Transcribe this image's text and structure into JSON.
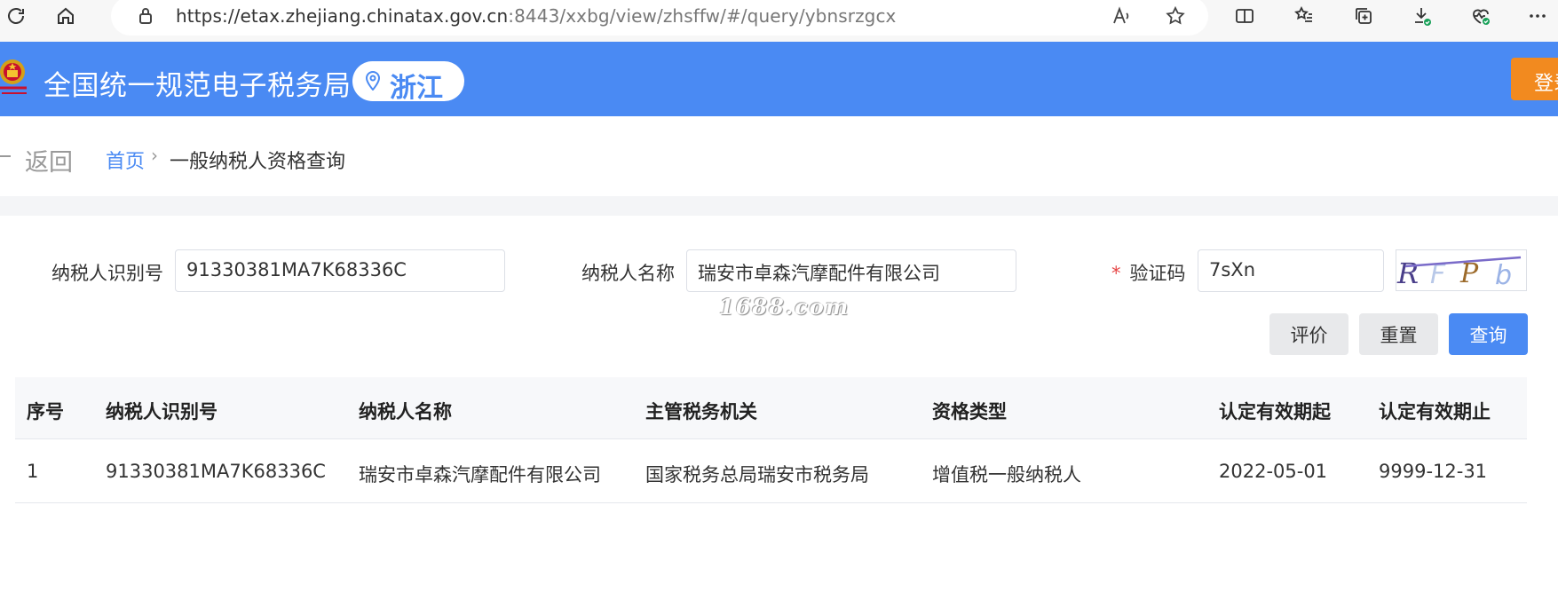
{
  "browser": {
    "url_host": "https://etax.zhejiang.chinatax.gov.cn",
    "url_path": ":8443/xxbg/view/zhsffw/#/query/ybnsrzgcx"
  },
  "header": {
    "title": "全国统一规范电子税务局",
    "region": "浙江",
    "login": "登录",
    "brand_color": "#4a8af3"
  },
  "breadcrumb": {
    "back": "返回",
    "home": "首页",
    "separator": "›",
    "current": "一般纳税人资格查询"
  },
  "form": {
    "taxpayer_id_label": "纳税人识别号",
    "taxpayer_id_value": "91330381MA7K68336C",
    "taxpayer_name_label": "纳税人名称",
    "taxpayer_name_value": "瑞安市卓森汽摩配件有限公司",
    "captcha_star": "*",
    "captcha_label": "验证码",
    "captcha_value": "7sXn",
    "captcha_image_text": "RFPb"
  },
  "watermark": "1688.com",
  "buttons": {
    "evaluate": "评价",
    "reset": "重置",
    "query": "查询"
  },
  "table": {
    "headers": [
      "序号",
      "纳税人识别号",
      "纳税人名称",
      "主管税务机关",
      "资格类型",
      "认定有效期起",
      "认定有效期止"
    ],
    "rows": [
      [
        "1",
        "91330381MA7K68336C",
        "瑞安市卓森汽摩配件有限公司",
        "国家税务总局瑞安市税务局",
        "增值税一般纳税人",
        "2022-05-01",
        "9999-12-31"
      ]
    ]
  }
}
